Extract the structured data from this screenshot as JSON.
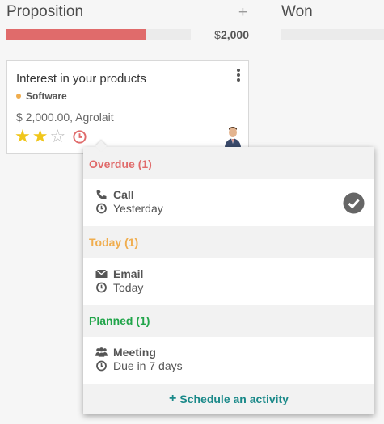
{
  "columns": [
    {
      "title": "Proposition",
      "add_icon": "plus-icon",
      "currency_symbol": "$",
      "amount": "2,000",
      "progress_percent": 76,
      "progress_color": "#e06b6b"
    },
    {
      "title": "Won",
      "progress_percent": 0
    }
  ],
  "card": {
    "title": "Interest in your products",
    "tag": "Software",
    "tag_color": "#f0ad4e",
    "amount_line": "$ 2,000.00, Agrolait",
    "priority_stars": 3,
    "priority_value": 2,
    "star_color": "#f0c61b"
  },
  "activities": {
    "overdue": {
      "header": "Overdue (1)",
      "color": "#e06b6b",
      "type": "Call",
      "type_icon": "phone-icon",
      "when": "Yesterday"
    },
    "today": {
      "header": "Today (1)",
      "color": "#f0ad4e",
      "type": "Email",
      "type_icon": "envelope-icon",
      "when": "Today"
    },
    "planned": {
      "header": "Planned (1)",
      "color": "#21a54a",
      "type": "Meeting",
      "type_icon": "users-icon",
      "when": "Due in 7 days"
    },
    "schedule_label": "Schedule an activity",
    "schedule_color": "#1a8989"
  }
}
